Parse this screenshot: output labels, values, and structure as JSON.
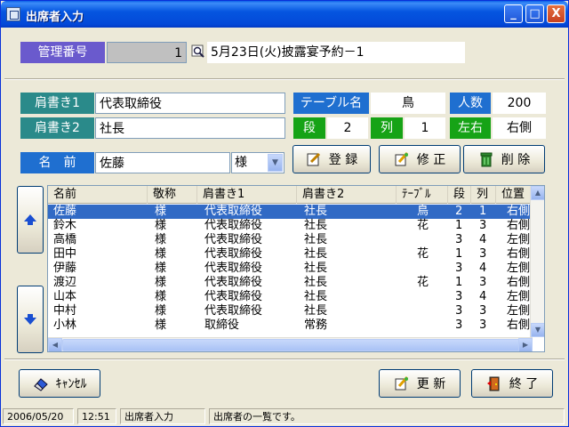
{
  "window": {
    "title": "出席者入力",
    "minimize_label": "_",
    "maximize_label": "□",
    "close_label": "X"
  },
  "header": {
    "management_label": "管理番号",
    "management_number": "1",
    "event_text": "5月23日(火)披露宴予約－1"
  },
  "form": {
    "title1_label": "肩書き1",
    "title1_value": "代表取締役",
    "title2_label": "肩書き2",
    "title2_value": "社長",
    "name_label": "名　前",
    "name_value": "佐藤",
    "honorific_value": "様",
    "table_label": "テーブル名",
    "table_value": "鳥",
    "count_label": "人数",
    "count_value": "200",
    "tier_label": "段",
    "tier_value": "2",
    "column_label": "列",
    "column_value": "1",
    "side_label": "左右",
    "side_value": "右側"
  },
  "buttons": {
    "register": "登 録",
    "edit": "修 正",
    "delete": "削 除",
    "cancel": "ｷｬﾝｾﾙ",
    "update": "更 新",
    "finish": "終 了"
  },
  "list": {
    "headers": [
      "名前",
      "敬称",
      "肩書き1",
      "肩書き2",
      "ﾃｰﾌﾞﾙ",
      "段",
      "列",
      "位置"
    ],
    "rows": [
      [
        "佐藤",
        "様",
        "代表取締役",
        "社長",
        "鳥",
        "2",
        "1",
        "右側"
      ],
      [
        "鈴木",
        "様",
        "代表取締役",
        "社長",
        "花",
        "1",
        "3",
        "右側"
      ],
      [
        "高橋",
        "様",
        "代表取締役",
        "社長",
        "",
        "3",
        "4",
        "左側"
      ],
      [
        "田中",
        "様",
        "代表取締役",
        "社長",
        "花",
        "1",
        "3",
        "右側"
      ],
      [
        "伊藤",
        "様",
        "代表取締役",
        "社長",
        "",
        "3",
        "4",
        "左側"
      ],
      [
        "渡辺",
        "様",
        "代表取締役",
        "社長",
        "花",
        "1",
        "3",
        "右側"
      ],
      [
        "山本",
        "様",
        "代表取締役",
        "社長",
        "",
        "3",
        "4",
        "左側"
      ],
      [
        "中村",
        "様",
        "代表取締役",
        "社長",
        "",
        "3",
        "3",
        "左側"
      ],
      [
        "小林",
        "様",
        "取締役",
        "常務",
        "",
        "3",
        "3",
        "右側"
      ]
    ],
    "selected_index": 0
  },
  "status": {
    "date": "2006/05/20",
    "time": "12:51",
    "screen": "出席者入力",
    "message": "出席者の一覧です。"
  },
  "colors": {
    "purple_label": "#6a5acd",
    "teal_label": "#2a8a8a",
    "blue_label": "#1f6fd0",
    "green_label": "#16a316",
    "selection": "#316ac5"
  },
  "icons": {
    "search": "magnifier-icon",
    "up": "up-arrow-icon",
    "down": "down-arrow-icon"
  }
}
